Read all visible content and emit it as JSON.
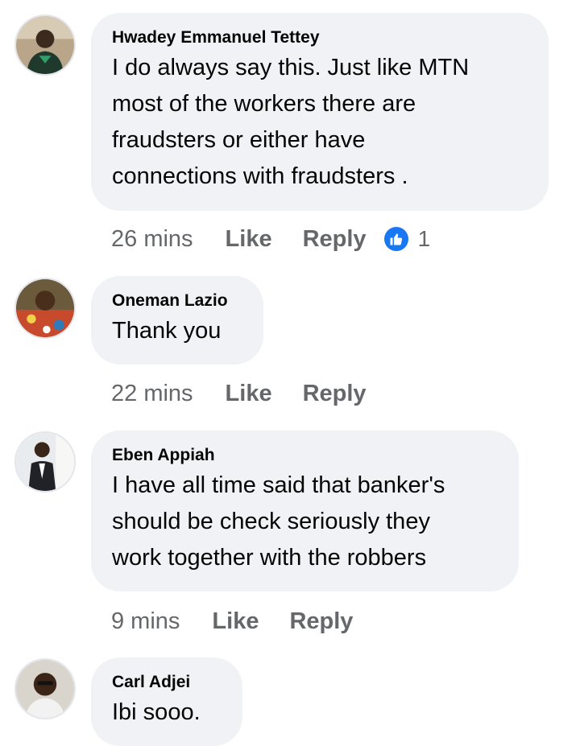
{
  "comments": [
    {
      "author": "Hwadey Emmanuel Tettey",
      "lines": [
        "I do always say this. Just like MTN",
        "most of the workers there are",
        "fraudsters or either have",
        "connections with fraudsters ."
      ],
      "time": "26 mins",
      "like_label": "Like",
      "reply_label": "Reply",
      "reaction_icon": "thumbs-up-icon",
      "reaction_count": "1"
    },
    {
      "author": "Oneman Lazio",
      "lines": [
        "Thank you"
      ],
      "time": "22 mins",
      "like_label": "Like",
      "reply_label": "Reply"
    },
    {
      "author": "Eben Appiah",
      "lines": [
        "I have all time said that banker's",
        "should be check seriously they",
        "work together with the robbers"
      ],
      "time": "9 mins",
      "like_label": "Like",
      "reply_label": "Reply"
    },
    {
      "author": "Carl Adjei",
      "lines": [
        "Ibi sooo."
      ]
    }
  ],
  "colors": {
    "bubble": "#f0f2f5",
    "meta_text": "#65676b",
    "reaction_blue": "#1877f2"
  }
}
